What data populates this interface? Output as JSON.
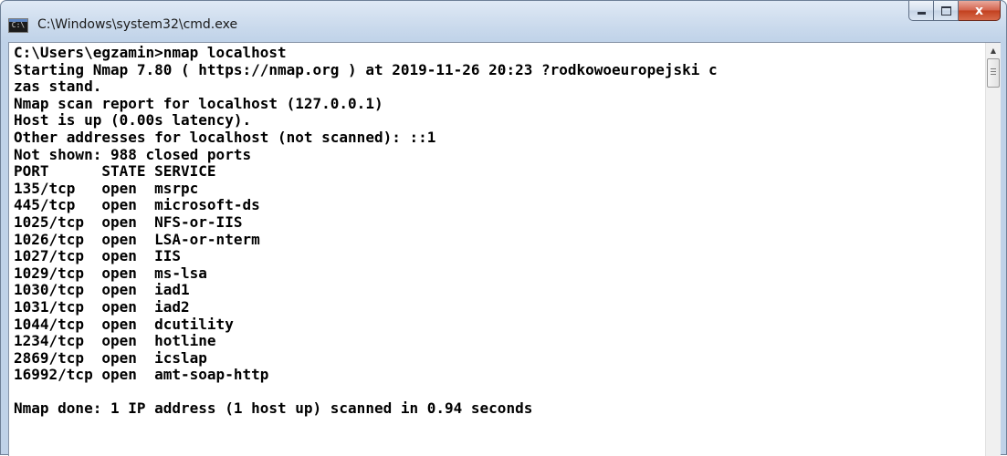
{
  "window": {
    "title": "C:\\Windows\\system32\\cmd.exe",
    "icon_label": "C:\\",
    "icon": "console-app-icon"
  },
  "caption_buttons": {
    "close_glyph": "x",
    "icons": [
      "minimize-icon",
      "maximize-icon",
      "close-icon"
    ]
  },
  "scrollbar": {
    "up_glyph": "▲"
  },
  "console": {
    "lines": [
      "C:\\Users\\egzamin>nmap localhost",
      "Starting Nmap 7.80 ( https://nmap.org ) at 2019-11-26 20:23 ?rodkowoeuropejski c",
      "zas stand.",
      "Nmap scan report for localhost (127.0.0.1)",
      "Host is up (0.00s latency).",
      "Other addresses for localhost (not scanned): ::1",
      "Not shown: 988 closed ports",
      "PORT      STATE SERVICE",
      "135/tcp   open  msrpc",
      "445/tcp   open  microsoft-ds",
      "1025/tcp  open  NFS-or-IIS",
      "1026/tcp  open  LSA-or-nterm",
      "1027/tcp  open  IIS",
      "1029/tcp  open  ms-lsa",
      "1030/tcp  open  iad1",
      "1031/tcp  open  iad2",
      "1044/tcp  open  dcutility",
      "1234/tcp  open  hotline",
      "2869/tcp  open  icslap",
      "16992/tcp open  amt-soap-http",
      "",
      "Nmap done: 1 IP address (1 host up) scanned in 0.94 seconds"
    ]
  }
}
